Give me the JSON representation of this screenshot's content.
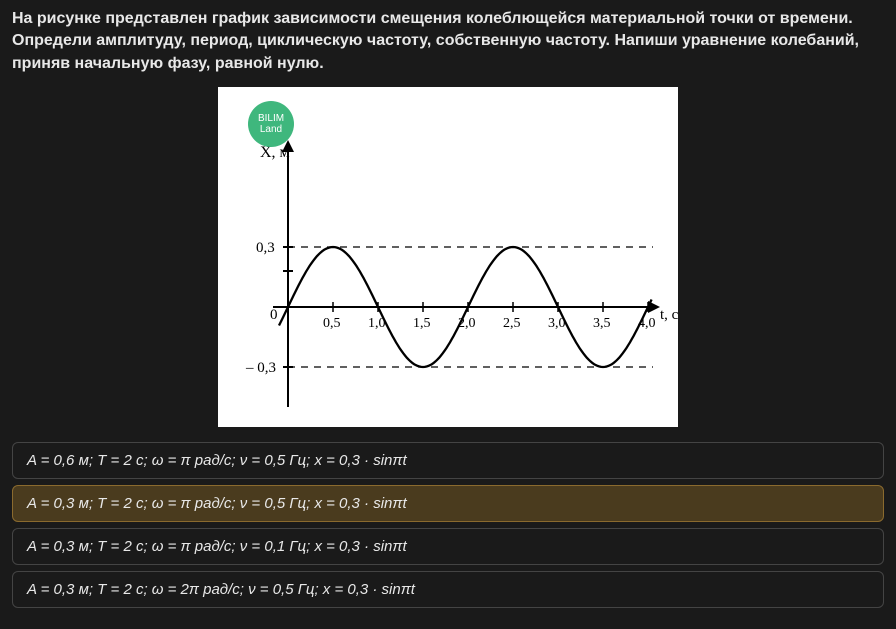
{
  "question": "На рисунке представлен график зависимости смещения колеблющейся материальной точки от времени. Определи амплитуду, период, циклическую частоту, собственную частоту. Напиши уравнение колебаний, приняв начальную фазу, равной нулю.",
  "badge": {
    "line1": "BILIM",
    "line2": "Land"
  },
  "chart": {
    "y_label": "X, м",
    "x_label": "t, с",
    "y_pos_tick": "0,3",
    "y_zero": "0",
    "y_neg_tick": "– 0,3",
    "x_ticks": [
      "0,5",
      "1,0",
      "1,5",
      "2,0",
      "2,5",
      "3,0",
      "3,5",
      "4,0"
    ]
  },
  "chart_data": {
    "type": "line",
    "title": "",
    "xlabel": "t, с",
    "ylabel": "X, м",
    "ylim": [
      -0.4,
      0.4
    ],
    "xlim": [
      0,
      4.0
    ],
    "x": [
      0,
      0.25,
      0.5,
      0.75,
      1.0,
      1.25,
      1.5,
      1.75,
      2.0,
      2.25,
      2.5,
      2.75,
      3.0,
      3.25,
      3.5,
      3.75,
      4.0
    ],
    "values": [
      0,
      0.21,
      0.3,
      0.21,
      0,
      -0.21,
      -0.3,
      -0.21,
      0,
      0.21,
      0.3,
      0.21,
      0,
      -0.21,
      -0.3,
      -0.21,
      0
    ],
    "amplitude": 0.3,
    "period": 2.0
  },
  "options": [
    {
      "text": "A = 0,6 м;  T = 2 с;  ω = π рад/с;  ν = 0,5 Гц;  x = 0,3 · sinπt",
      "selected": false
    },
    {
      "text": "A = 0,3 м;  T = 2 с;  ω = π рад/с;  ν = 0,5 Гц;  x = 0,3 · sinπt",
      "selected": true
    },
    {
      "text": "A = 0,3 м;  T = 2 с;  ω = π рад/с;  ν = 0,1 Гц;  x = 0,3 · sinπt",
      "selected": false
    },
    {
      "text": "A = 0,3 м;  T = 2 с;  ω = 2π рад/с;  ν = 0,5 Гц;  x = 0,3 · sinπt",
      "selected": false
    }
  ]
}
